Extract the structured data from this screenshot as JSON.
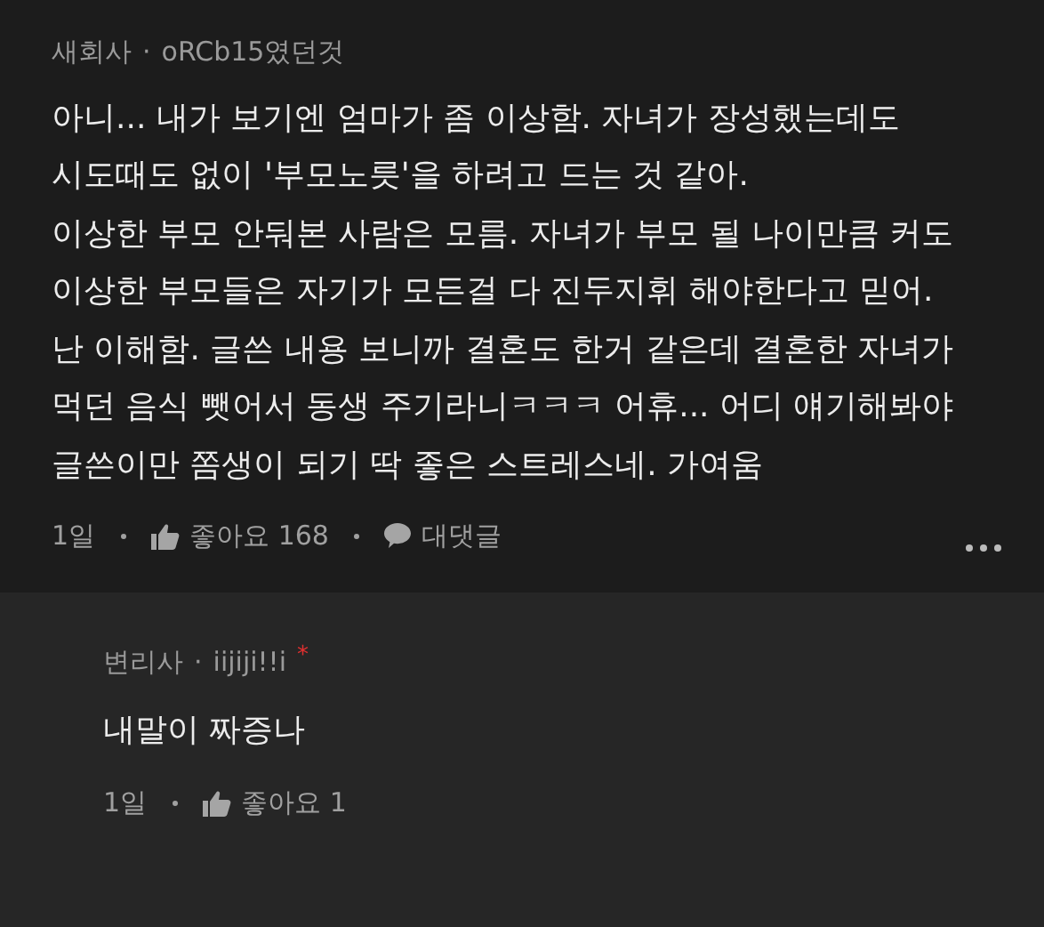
{
  "comment": {
    "author": "새회사",
    "separator": "·",
    "nickname": "oRCb15였던것",
    "lines": [
      "아니... 내가 보기엔 엄마가 좀 이상함. 자녀가 장성했는데도",
      "시도때도 없이 '부모노릇'을 하려고 드는 것 같아.",
      "이상한 부모 안둬본 사람은 모름. 자녀가 부모 될 나이만큼 커도",
      "이상한 부모들은 자기가 모든걸 다 진두지휘 해야한다고 믿어.",
      "난 이해함. 글쓴 내용 보니까 결혼도 한거 같은데 결혼한 자녀가",
      "먹던 음식 뺏어서 동생 주기라니ㅋㅋㅋ 어휴... 어디 얘기해봐야",
      "글쓴이만 쫌생이 되기 딱 좋은 스트레스네. 가여움"
    ],
    "time": "1일",
    "likes": "좋아요 168",
    "reply_label": "대댓글"
  },
  "reply": {
    "author": "변리사",
    "separator": "·",
    "nickname": "iijiji!!i",
    "author_mark": "*",
    "text": "내말이 짜증나",
    "time": "1일",
    "likes": "좋아요 1"
  }
}
